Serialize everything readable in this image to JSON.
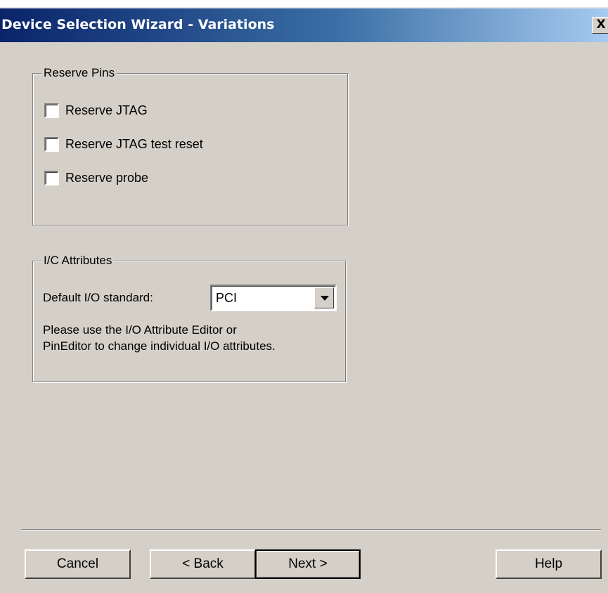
{
  "window": {
    "title": "Device Selection Wizard - Variations",
    "close_label": "X"
  },
  "reserve_pins": {
    "legend": "Reserve Pins",
    "items": [
      {
        "label": "Reserve JTAG",
        "checked": false
      },
      {
        "label": "Reserve JTAG test reset",
        "checked": false
      },
      {
        "label": "Reserve probe",
        "checked": false
      }
    ]
  },
  "io_attributes": {
    "legend": "I/C Attributes",
    "default_label": "Default I/O standard:",
    "default_value": "PCI",
    "help_line1": "Please use the I/O Attribute Editor or",
    "help_line2": "PinEditor to change individual I/O attributes."
  },
  "buttons": {
    "cancel": "Cancel",
    "back": "< Back",
    "next": "Next >",
    "help": "Help"
  }
}
